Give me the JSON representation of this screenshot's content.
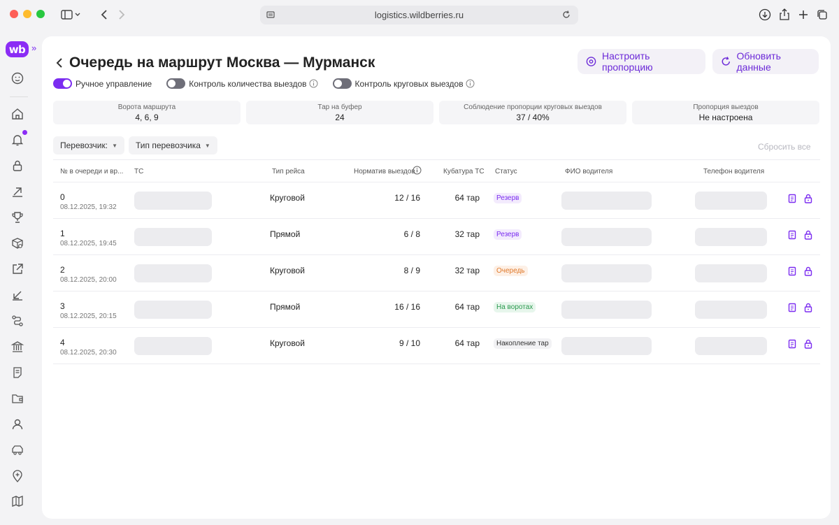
{
  "browser": {
    "url": "logistics.wildberries.ru"
  },
  "sidebar": {
    "logo": "wb",
    "expand_icon": "»",
    "icons": [
      "profile-icon",
      "home-icon",
      "bell-icon",
      "lock-icon",
      "arrow-up-right-icon",
      "trophy-icon",
      "box-search-icon",
      "external-link-icon",
      "arrow-down-left-icon",
      "route-icon",
      "bank-icon",
      "document-icon",
      "folder-icon",
      "person-icon",
      "car-icon",
      "location-plus-icon",
      "map-icon"
    ]
  },
  "header": {
    "title": "Очередь на маршрут Москва — Мурманск",
    "btn_proportion": "Настроить пропорцию",
    "btn_refresh": "Обновить данные"
  },
  "toggles": [
    {
      "label": "Ручное управление",
      "on": true
    },
    {
      "label": "Контроль количества выездов",
      "on": false
    },
    {
      "label": "Контроль круговых выездов",
      "on": false
    }
  ],
  "stats": [
    {
      "label": "Ворота маршрута",
      "value": "4, 6, 9"
    },
    {
      "label": "Тар на буфер",
      "value": "24"
    },
    {
      "label": "Соблюдение пропорции круговых выездов",
      "value": "37 / 40%"
    },
    {
      "label": "Пропорция выездов",
      "value": "Не настроена"
    }
  ],
  "filters": {
    "carrier": "Перевозчик:",
    "carrier_type": "Тип перевозчика",
    "reset": "Сбросить все"
  },
  "table": {
    "headers": {
      "num": "№ в очереди и вр...",
      "ts": "ТС",
      "trip_type": "Тип рейса",
      "norm": "Норматив выездов",
      "cubature": "Кубатура ТС",
      "status": "Статус",
      "fio": "ФИО водителя",
      "phone": "Телефон водителя"
    },
    "rows": [
      {
        "num": "0",
        "date": "08.12.2025, 19:32",
        "type": "Круговой",
        "norm": "12 / 16",
        "cub": "64 тар",
        "status": "Резерв",
        "status_kind": "reserve"
      },
      {
        "num": "1",
        "date": "08.12.2025, 19:45",
        "type": "Прямой",
        "norm": "6 / 8",
        "cub": "32 тар",
        "status": "Резерв",
        "status_kind": "reserve"
      },
      {
        "num": "2",
        "date": "08.12.2025, 20:00",
        "type": "Круговой",
        "norm": "8 / 9",
        "cub": "32 тар",
        "status": "Очередь",
        "status_kind": "queue"
      },
      {
        "num": "3",
        "date": "08.12.2025, 20:15",
        "type": "Прямой",
        "norm": "16 / 16",
        "cub": "64 тар",
        "status": "На воротах",
        "status_kind": "gate"
      },
      {
        "num": "4",
        "date": "08.12.2025, 20:30",
        "type": "Круговой",
        "norm": "9 / 10",
        "cub": "64 тар",
        "status": "Накопление тар",
        "status_kind": "accum"
      }
    ]
  },
  "colors": {
    "accent": "#7b2cf0",
    "brand": "#8b2cf5"
  }
}
